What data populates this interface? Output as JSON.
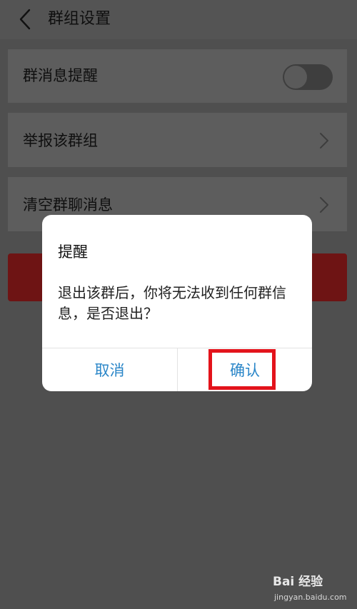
{
  "header": {
    "title": "群组设置",
    "back_icon": "chevron-left-icon"
  },
  "settings": {
    "rows": [
      {
        "label": "群消息提醒",
        "control": "toggle",
        "toggle_on": false
      },
      {
        "label": "举报该群组",
        "control": "chevron-right-icon"
      },
      {
        "label": "清空群聊消息",
        "control": "chevron-right-icon"
      }
    ],
    "exit_button_color": "#6e1414"
  },
  "dialog": {
    "title": "提醒",
    "message": "退出该群后，你将无法收到任何群信息，是否退出？",
    "cancel_label": "取消",
    "confirm_label": "确认",
    "button_color": "#2a86c8"
  },
  "annotation": {
    "highlight_color": "#e3131b",
    "highlights": "confirm-button"
  },
  "watermark": {
    "logo_text": "Bai 经验",
    "url": "jingyan.baidu.com"
  }
}
